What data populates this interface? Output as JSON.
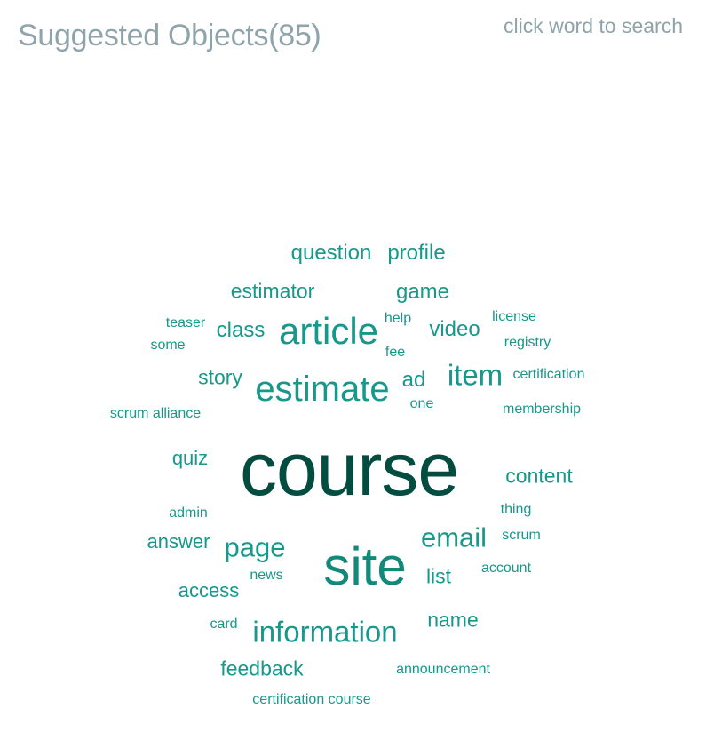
{
  "header": {
    "title": "Suggested Objects(85)",
    "hint": "click word to search"
  },
  "colors": {
    "title": "#8fa3ab",
    "word_default": "#17988a",
    "word_mid": "#128a7a",
    "word_top": "#024d40"
  },
  "words": [
    {
      "text": "course",
      "weight": 100,
      "tone": "top"
    },
    {
      "text": "site",
      "weight": 62,
      "tone": "mid"
    },
    {
      "text": "article",
      "weight": 44,
      "tone": "default"
    },
    {
      "text": "estimate",
      "weight": 44,
      "tone": "default"
    },
    {
      "text": "information",
      "weight": 36,
      "tone": "default"
    },
    {
      "text": "item",
      "weight": 36,
      "tone": "default"
    },
    {
      "text": "email",
      "weight": 34,
      "tone": "default"
    },
    {
      "text": "page",
      "weight": 34,
      "tone": "default"
    },
    {
      "text": "question",
      "weight": 26,
      "tone": "default"
    },
    {
      "text": "profile",
      "weight": 26,
      "tone": "default"
    },
    {
      "text": "estimator",
      "weight": 26,
      "tone": "default"
    },
    {
      "text": "game",
      "weight": 26,
      "tone": "default"
    },
    {
      "text": "class",
      "weight": 26,
      "tone": "default"
    },
    {
      "text": "video",
      "weight": 26,
      "tone": "default"
    },
    {
      "text": "story",
      "weight": 25,
      "tone": "default"
    },
    {
      "text": "ad",
      "weight": 25,
      "tone": "default"
    },
    {
      "text": "quiz",
      "weight": 24,
      "tone": "default"
    },
    {
      "text": "content",
      "weight": 25,
      "tone": "default"
    },
    {
      "text": "answer",
      "weight": 24,
      "tone": "default"
    },
    {
      "text": "list",
      "weight": 25,
      "tone": "default"
    },
    {
      "text": "access",
      "weight": 24,
      "tone": "default"
    },
    {
      "text": "name",
      "weight": 25,
      "tone": "default"
    },
    {
      "text": "feedback",
      "weight": 25,
      "tone": "default"
    },
    {
      "text": "teaser",
      "weight": 16,
      "tone": "default"
    },
    {
      "text": "some",
      "weight": 16,
      "tone": "default"
    },
    {
      "text": "help",
      "weight": 16,
      "tone": "default"
    },
    {
      "text": "fee",
      "weight": 16,
      "tone": "default"
    },
    {
      "text": "license",
      "weight": 16,
      "tone": "default"
    },
    {
      "text": "registry",
      "weight": 16,
      "tone": "default"
    },
    {
      "text": "certification",
      "weight": 16,
      "tone": "default"
    },
    {
      "text": "one",
      "weight": 16,
      "tone": "default"
    },
    {
      "text": "membership",
      "weight": 16,
      "tone": "default"
    },
    {
      "text": "scrum alliance",
      "weight": 16,
      "tone": "default"
    },
    {
      "text": "admin",
      "weight": 16,
      "tone": "default"
    },
    {
      "text": "thing",
      "weight": 16,
      "tone": "default"
    },
    {
      "text": "scrum",
      "weight": 16,
      "tone": "default"
    },
    {
      "text": "news",
      "weight": 16,
      "tone": "default"
    },
    {
      "text": "account",
      "weight": 16,
      "tone": "default"
    },
    {
      "text": "card",
      "weight": 16,
      "tone": "default"
    },
    {
      "text": "announcement",
      "weight": 16,
      "tone": "default"
    },
    {
      "text": "certification course",
      "weight": 16,
      "tone": "default"
    }
  ]
}
